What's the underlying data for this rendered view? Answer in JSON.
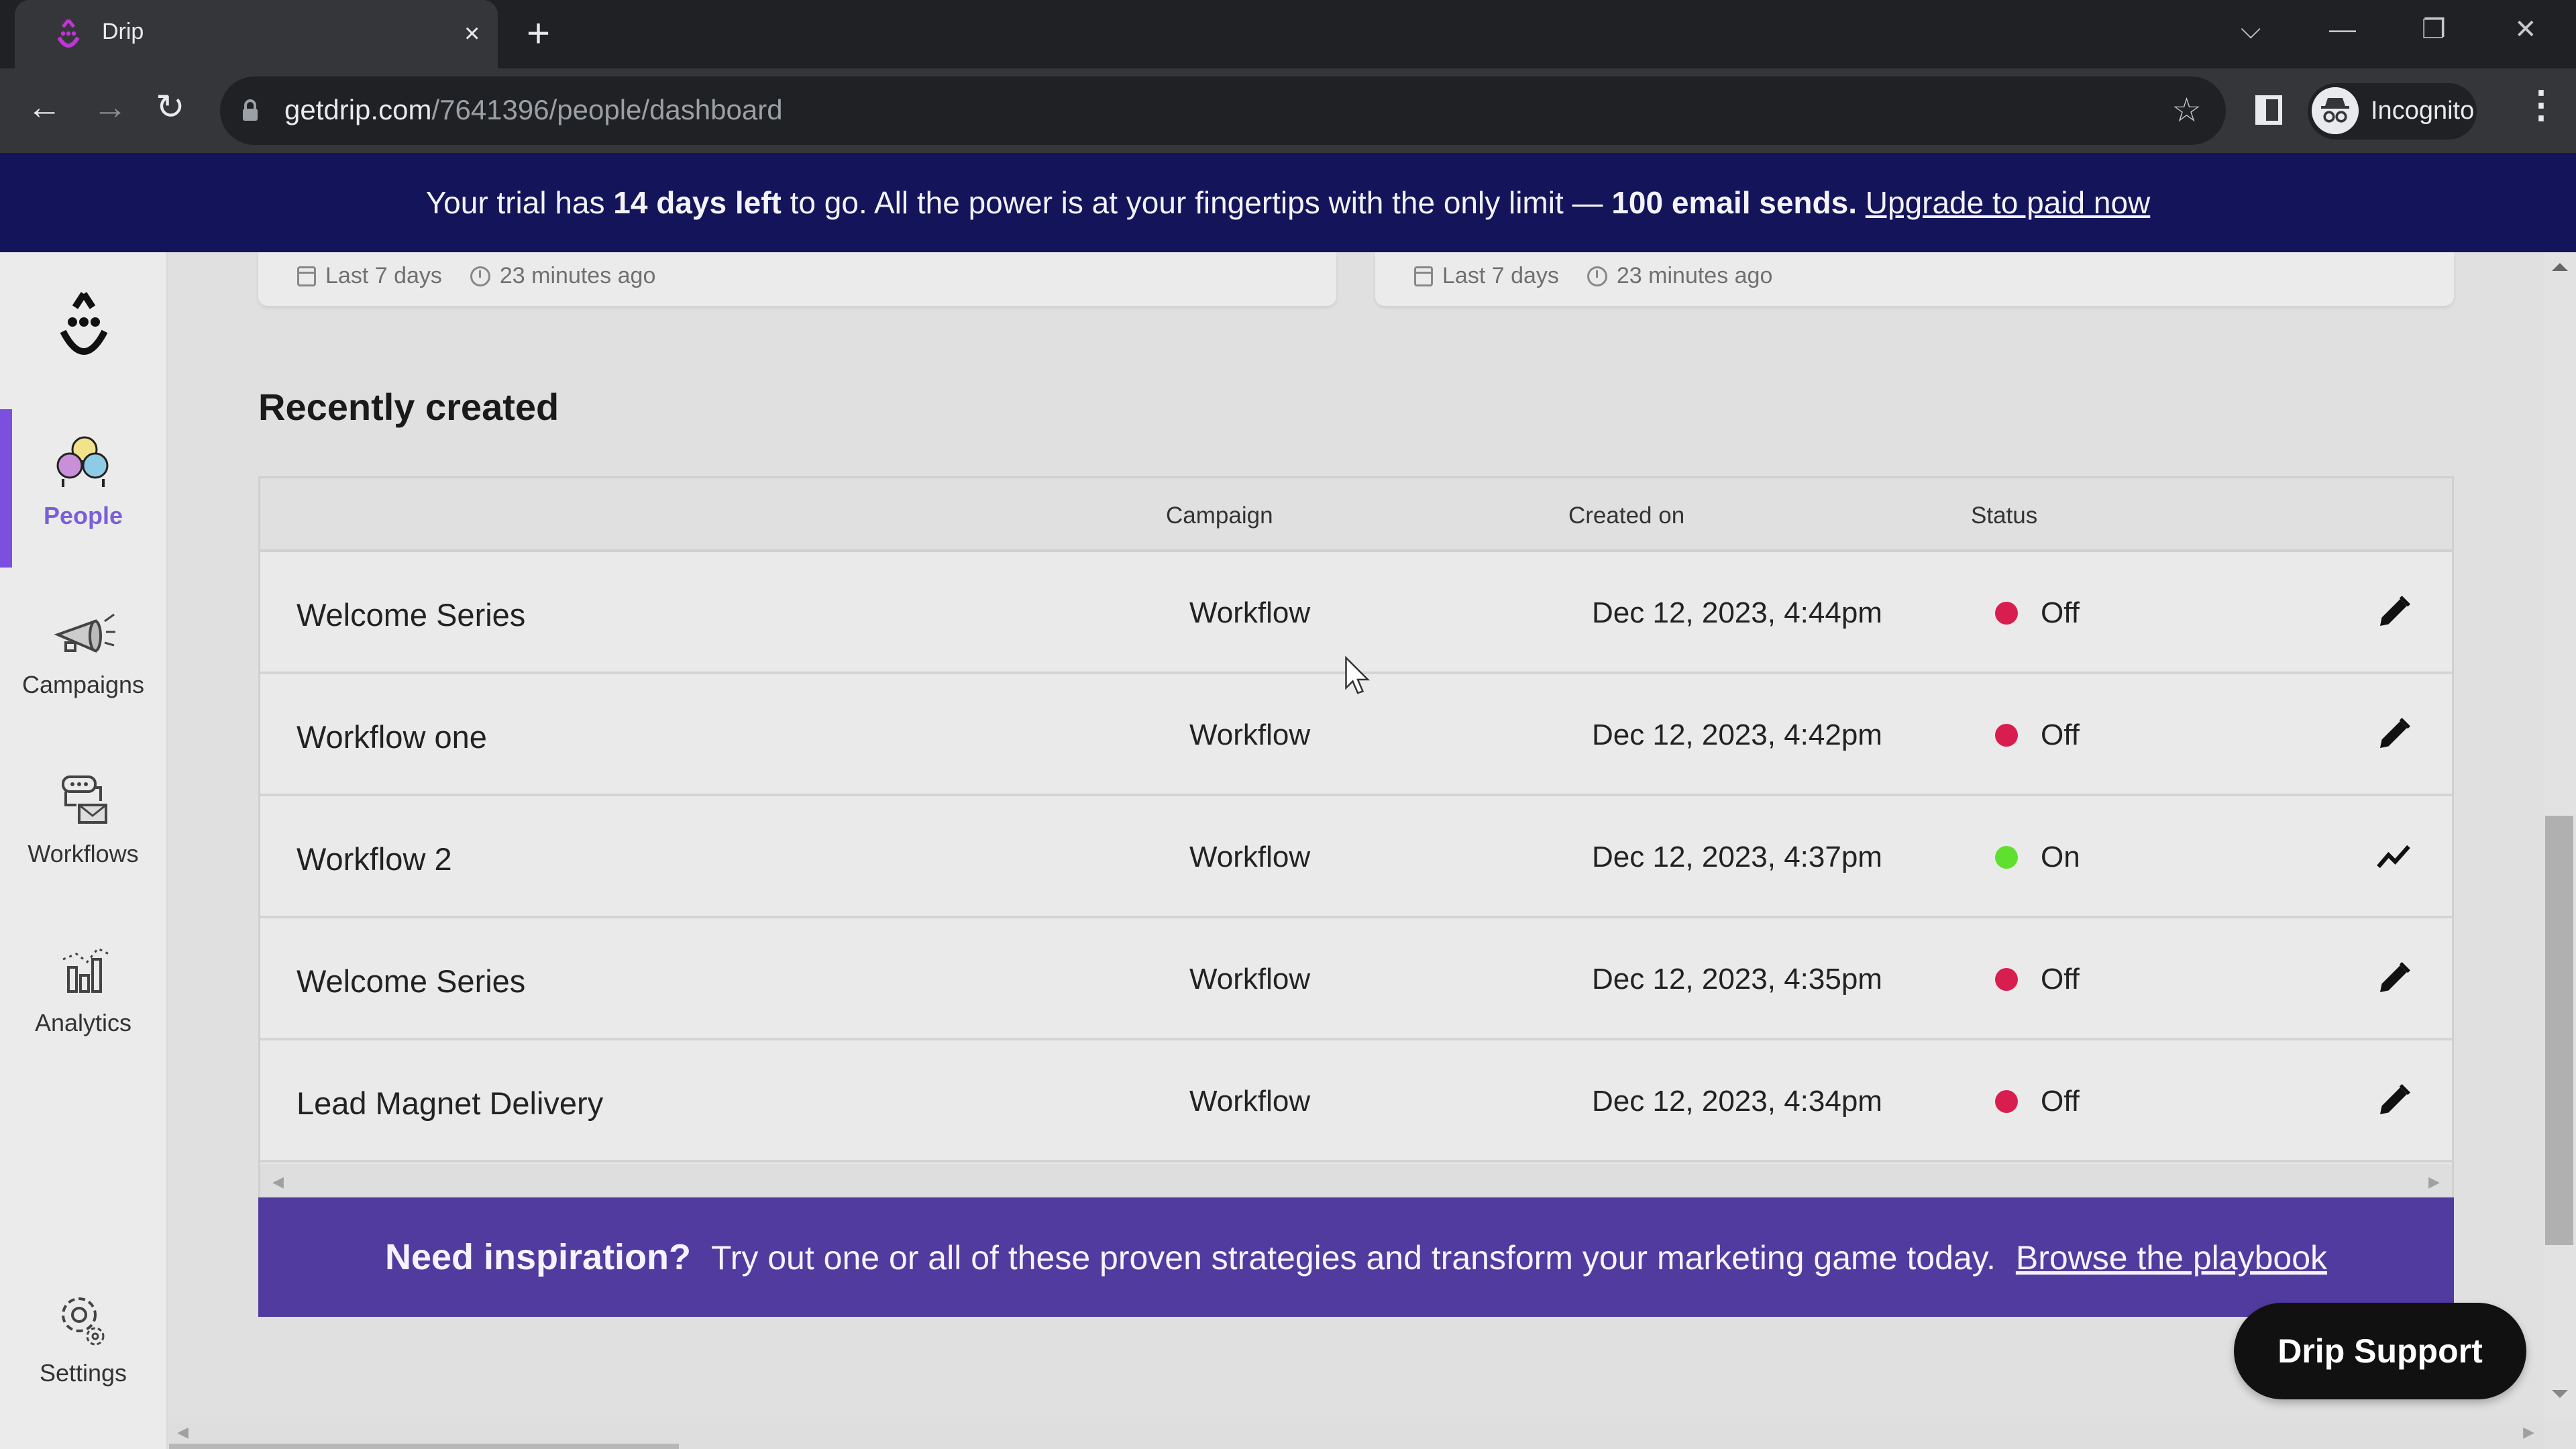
{
  "browser": {
    "tab_title": "Drip",
    "tab_close": "×",
    "new_tab": "+",
    "url_host": "getdrip.com",
    "url_path": "/7641396/people/dashboard",
    "profile_label": "Incognito",
    "window_controls": {
      "tab_search": "⌵",
      "minimize": "—",
      "restore": "❐",
      "close": "✕"
    },
    "nav": {
      "back": "←",
      "forward": "→",
      "reload": "↻"
    },
    "star": "☆",
    "menu": "⋮"
  },
  "trial_banner": {
    "prefix": "Your trial has ",
    "days_left": "14 days left",
    "middle": " to go. All the power is at your fingertips with the only limit — ",
    "limit": "100 email sends.",
    "link": "Upgrade to paid now"
  },
  "sidebar": {
    "items": [
      {
        "label": "People",
        "icon": "people-icon",
        "active": true
      },
      {
        "label": "Campaigns",
        "icon": "megaphone-icon",
        "active": false
      },
      {
        "label": "Workflows",
        "icon": "workflow-icon",
        "active": false
      },
      {
        "label": "Analytics",
        "icon": "analytics-icon",
        "active": false
      },
      {
        "label": "Settings",
        "icon": "gear-icon",
        "active": false
      }
    ]
  },
  "cards": [
    {
      "range": "Last 7 days",
      "updated": "23 minutes ago"
    },
    {
      "range": "Last 7 days",
      "updated": "23 minutes ago"
    }
  ],
  "recent": {
    "title": "Recently created",
    "columns": [
      "",
      "Campaign",
      "Created on",
      "Status",
      ""
    ],
    "rows": [
      {
        "name": "Welcome Series",
        "campaign": "Workflow",
        "created": "Dec 12, 2023, 4:44pm",
        "status": "Off",
        "action": "edit-icon"
      },
      {
        "name": "Workflow one",
        "campaign": "Workflow",
        "created": "Dec 12, 2023, 4:42pm",
        "status": "Off",
        "action": "edit-icon"
      },
      {
        "name": "Workflow 2",
        "campaign": "Workflow",
        "created": "Dec 12, 2023, 4:37pm",
        "status": "On",
        "action": "stats-icon"
      },
      {
        "name": "Welcome Series",
        "campaign": "Workflow",
        "created": "Dec 12, 2023, 4:35pm",
        "status": "Off",
        "action": "edit-icon"
      },
      {
        "name": "Lead Magnet Delivery",
        "campaign": "Workflow",
        "created": "Dec 12, 2023, 4:34pm",
        "status": "Off",
        "action": "edit-icon"
      }
    ]
  },
  "inspiration": {
    "heading": "Need inspiration?",
    "text": "Try out one or all of these proven strategies and transform your marketing game today.",
    "link": "Browse the playbook"
  },
  "support_button": "Drip Support",
  "colors": {
    "brand_purple": "#7b4fe0",
    "banner_navy": "#14145a",
    "inspire_purple": "#513b9f",
    "status_off": "#d81e4e",
    "status_on": "#5fe02f"
  }
}
